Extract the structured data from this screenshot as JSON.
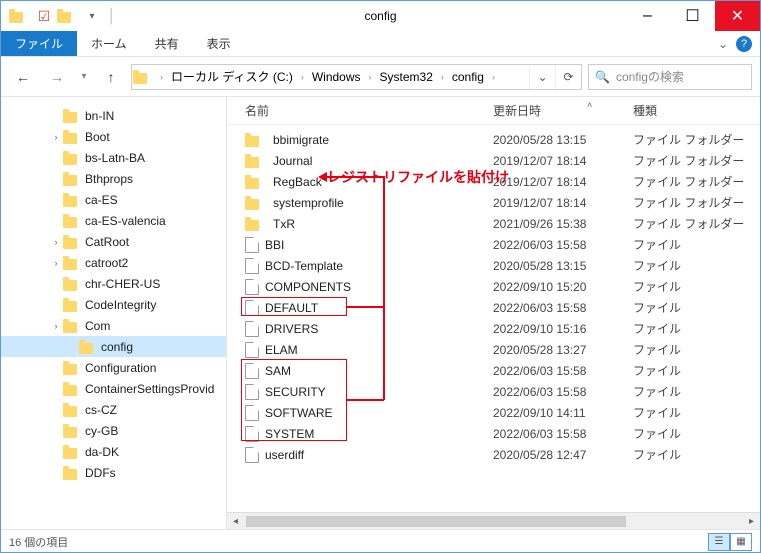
{
  "title": "config",
  "ribbon": {
    "tabs": [
      "ファイル",
      "ホーム",
      "共有",
      "表示"
    ]
  },
  "breadcrumbs": [
    "ローカル ディスク (C:)",
    "Windows",
    "System32",
    "config"
  ],
  "search_placeholder": "configの検索",
  "columns": {
    "name": "名前",
    "date": "更新日時",
    "type": "種類"
  },
  "tree": [
    {
      "label": "bn-IN",
      "depth": 2,
      "twist": ""
    },
    {
      "label": "Boot",
      "depth": 2,
      "twist": ">"
    },
    {
      "label": "bs-Latn-BA",
      "depth": 2,
      "twist": ""
    },
    {
      "label": "Bthprops",
      "depth": 2,
      "twist": ""
    },
    {
      "label": "ca-ES",
      "depth": 2,
      "twist": ""
    },
    {
      "label": "ca-ES-valencia",
      "depth": 2,
      "twist": ""
    },
    {
      "label": "CatRoot",
      "depth": 2,
      "twist": ">"
    },
    {
      "label": "catroot2",
      "depth": 2,
      "twist": ">"
    },
    {
      "label": "chr-CHER-US",
      "depth": 2,
      "twist": ""
    },
    {
      "label": "CodeIntegrity",
      "depth": 2,
      "twist": ""
    },
    {
      "label": "Com",
      "depth": 2,
      "twist": ">"
    },
    {
      "label": "config",
      "depth": 3,
      "twist": "",
      "selected": true
    },
    {
      "label": "Configuration",
      "depth": 2,
      "twist": ""
    },
    {
      "label": "ContainerSettingsProvid",
      "depth": 2,
      "twist": ""
    },
    {
      "label": "cs-CZ",
      "depth": 2,
      "twist": ""
    },
    {
      "label": "cy-GB",
      "depth": 2,
      "twist": ""
    },
    {
      "label": "da-DK",
      "depth": 2,
      "twist": ""
    },
    {
      "label": "DDFs",
      "depth": 2,
      "twist": ""
    }
  ],
  "files": [
    {
      "name": "bbimigrate",
      "kind": "folder",
      "date": "2020/05/28 13:15",
      "type": "ファイル フォルダー"
    },
    {
      "name": "Journal",
      "kind": "folder",
      "date": "2019/12/07 18:14",
      "type": "ファイル フォルダー"
    },
    {
      "name": "RegBack",
      "kind": "folder",
      "date": "2019/12/07 18:14",
      "type": "ファイル フォルダー"
    },
    {
      "name": "systemprofile",
      "kind": "folder",
      "date": "2019/12/07 18:14",
      "type": "ファイル フォルダー"
    },
    {
      "name": "TxR",
      "kind": "folder",
      "date": "2021/09/26 15:38",
      "type": "ファイル フォルダー"
    },
    {
      "name": "BBI",
      "kind": "file",
      "date": "2022/06/03 15:58",
      "type": "ファイル"
    },
    {
      "name": "BCD-Template",
      "kind": "file",
      "date": "2020/05/28 13:15",
      "type": "ファイル"
    },
    {
      "name": "COMPONENTS",
      "kind": "file",
      "date": "2022/09/10 15:20",
      "type": "ファイル"
    },
    {
      "name": "DEFAULT",
      "kind": "file",
      "date": "2022/06/03 15:58",
      "type": "ファイル"
    },
    {
      "name": "DRIVERS",
      "kind": "file",
      "date": "2022/09/10 15:16",
      "type": "ファイル"
    },
    {
      "name": "ELAM",
      "kind": "file",
      "date": "2020/05/28 13:27",
      "type": "ファイル"
    },
    {
      "name": "SAM",
      "kind": "file",
      "date": "2022/06/03 15:58",
      "type": "ファイル"
    },
    {
      "name": "SECURITY",
      "kind": "file",
      "date": "2022/06/03 15:58",
      "type": "ファイル"
    },
    {
      "name": "SOFTWARE",
      "kind": "file",
      "date": "2022/09/10 14:11",
      "type": "ファイル"
    },
    {
      "name": "SYSTEM",
      "kind": "file",
      "date": "2022/06/03 15:58",
      "type": "ファイル"
    },
    {
      "name": "userdiff",
      "kind": "file",
      "date": "2020/05/28 12:47",
      "type": "ファイル"
    }
  ],
  "annotation": {
    "text": "レジストリファイルを貼付け"
  },
  "status": {
    "items": "16 個の項目"
  }
}
